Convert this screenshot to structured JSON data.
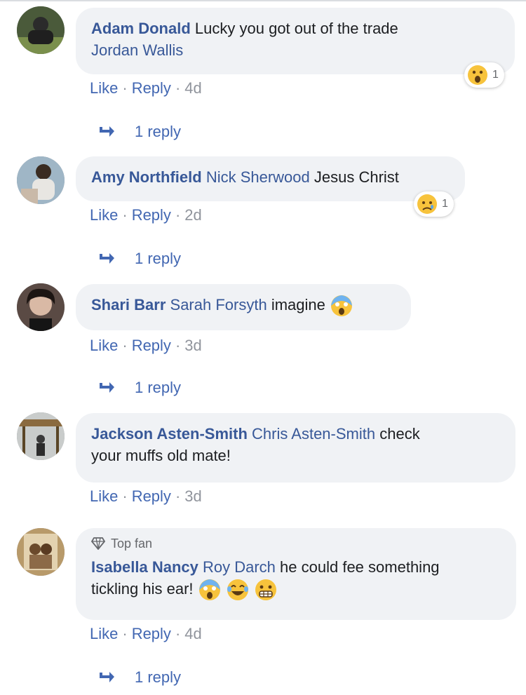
{
  "comments": [
    {
      "author": "Adam Donald",
      "mention": "",
      "text_line1": "Lucky you got out of the trade",
      "tag_line2": "Jordan Wallis",
      "like": "Like",
      "reply": "Reply",
      "time": "4d",
      "reaction": {
        "icon": "wow-emoji-icon",
        "count": "1"
      },
      "replies": "1 reply"
    },
    {
      "author": "Amy Northfield",
      "mention": "Nick Sherwood",
      "text": "Jesus Christ",
      "like": "Like",
      "reply": "Reply",
      "time": "2d",
      "reaction": {
        "icon": "sad-emoji-icon",
        "count": "1"
      },
      "replies": "1 reply"
    },
    {
      "author": "Shari Barr",
      "mention": "Sarah Forsyth",
      "text": "imagine",
      "emoji": "scream-emoji-icon",
      "like": "Like",
      "reply": "Reply",
      "time": "3d",
      "replies": "1 reply"
    },
    {
      "author": "Jackson Asten-Smith",
      "mention": "Chris Asten-Smith",
      "text_line1": "check",
      "text_line2": "your muffs old mate!",
      "like": "Like",
      "reply": "Reply",
      "time": "3d"
    },
    {
      "badge": "Top fan",
      "author": "Isabella Nancy",
      "mention": "Roy Darch",
      "text_line1": "he could fee something",
      "text_line2": "tickling his ear!",
      "emojis": [
        "scream-emoji-icon",
        "joy-emoji-icon",
        "grimace-emoji-icon"
      ],
      "like": "Like",
      "reply": "Reply",
      "time": "4d",
      "replies": "1 reply"
    }
  ],
  "colors": {
    "link": "#385898",
    "action": "#4267b2",
    "bubble": "#f0f2f5",
    "muted": "#90949c"
  }
}
